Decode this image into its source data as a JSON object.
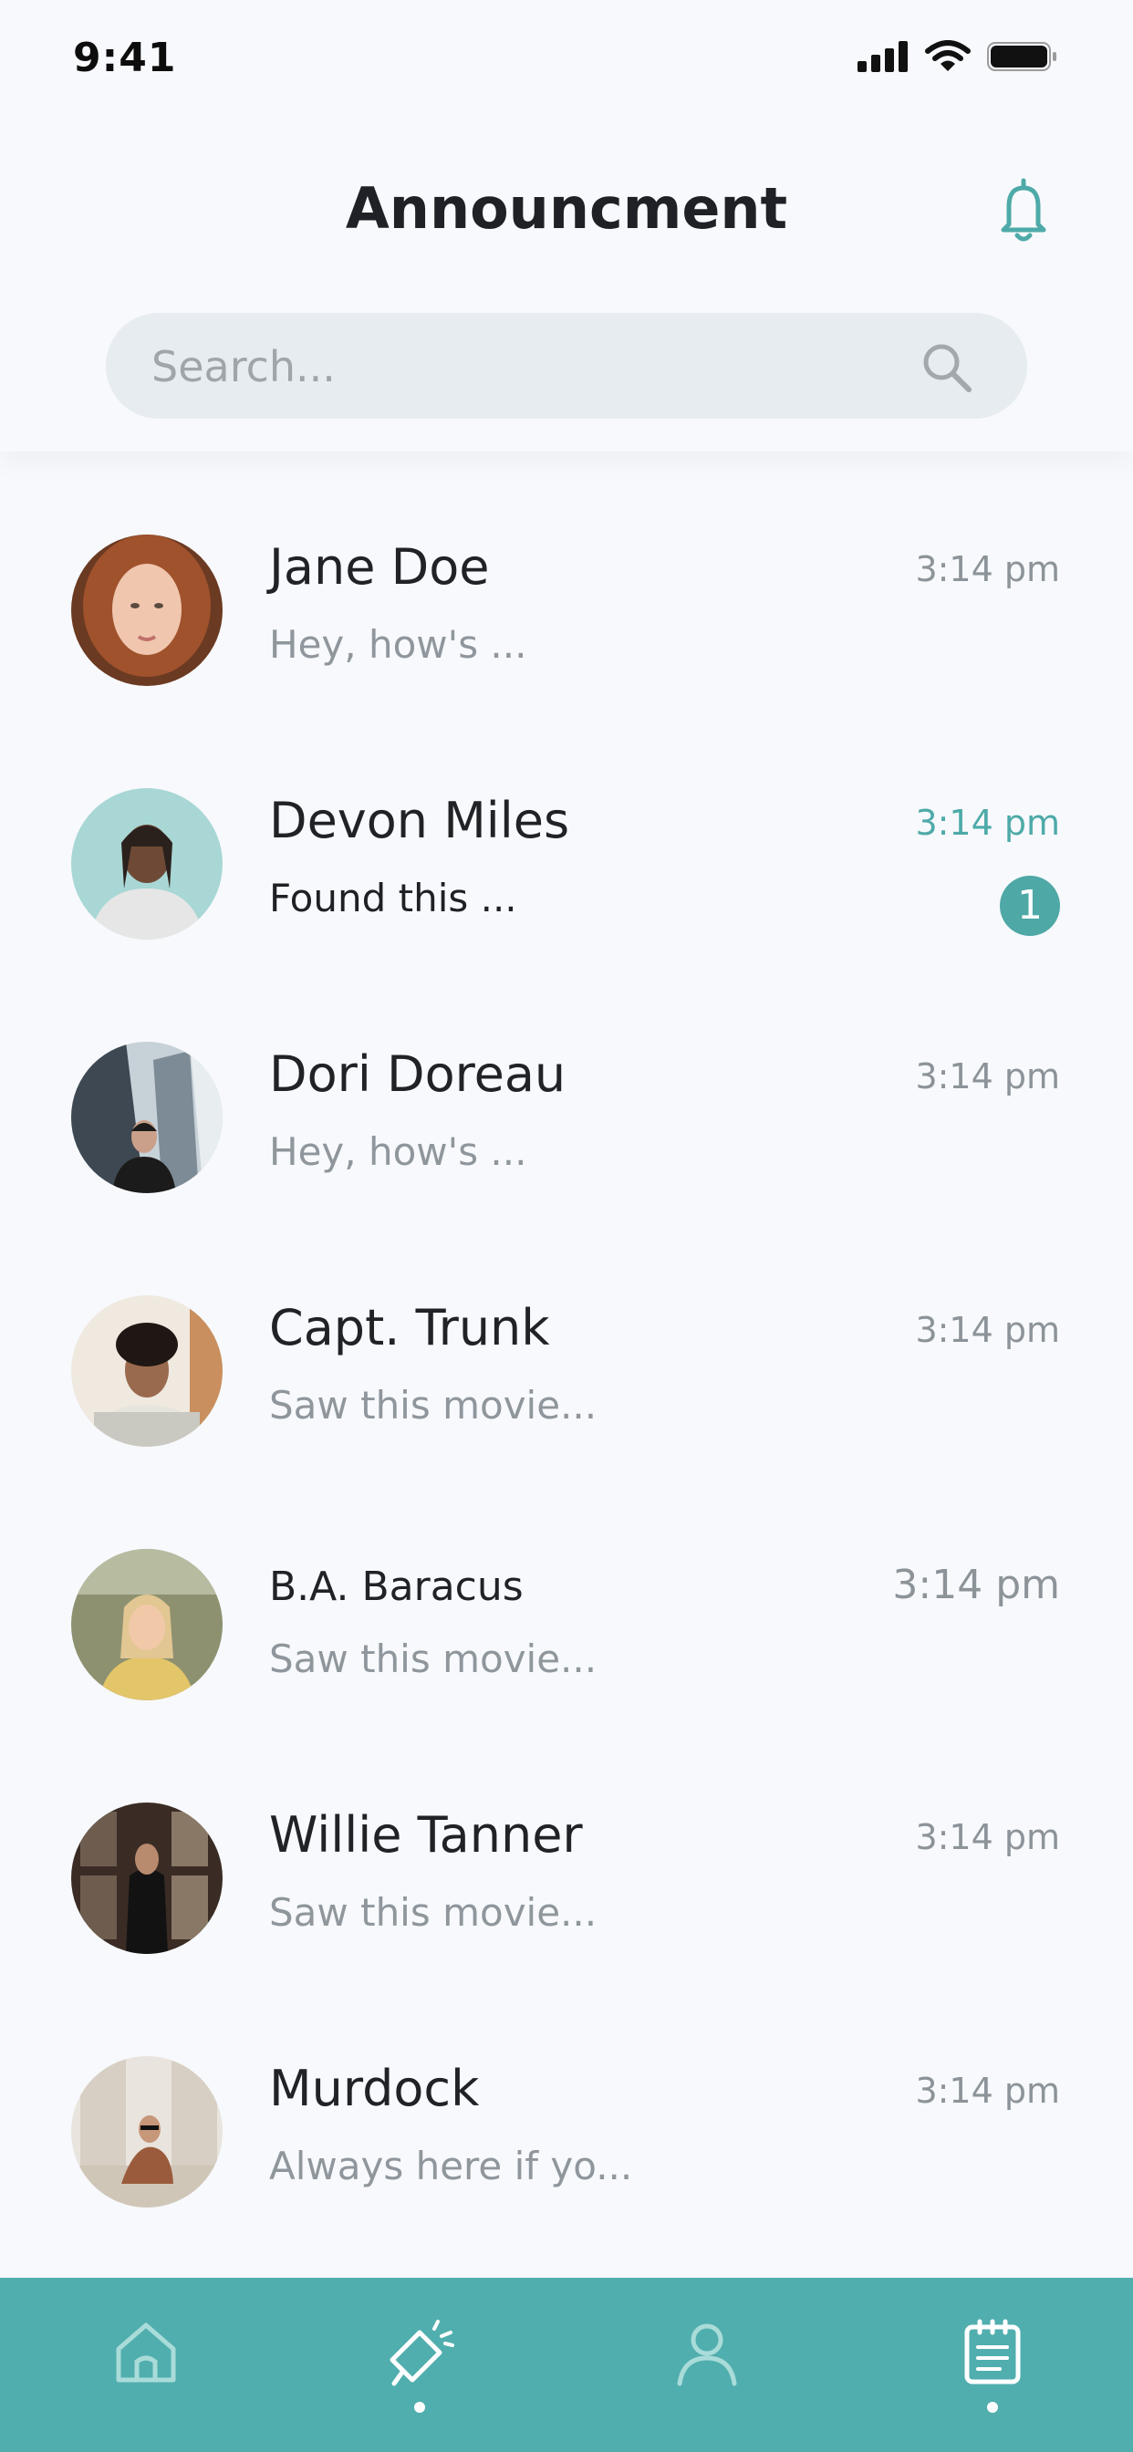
{
  "status": {
    "time": "9:41"
  },
  "header": {
    "title": "Announcment"
  },
  "search": {
    "placeholder": "Search..."
  },
  "colors": {
    "accent": "#4eaaa8",
    "nav_bg": "#51aeae",
    "muted": "#8f969c"
  },
  "messages": [
    {
      "name": "Jane Doe",
      "preview": "Hey, how's ...",
      "time": "3:14 pm"
    },
    {
      "name": "Devon Miles",
      "preview": "Found this ...",
      "time": "3:14 pm",
      "unread": 1
    },
    {
      "name": "Dori Doreau",
      "preview": "Hey, how's ...",
      "time": "3:14 pm"
    },
    {
      "name": "Capt. Trunk",
      "preview": "Saw this movie...",
      "time": "3:14 pm"
    },
    {
      "name": "B.A. Baracus",
      "preview": "Saw this movie...",
      "time": "3:14 pm"
    },
    {
      "name": "Willie Tanner",
      "preview": "Saw this movie...",
      "time": "3:14 pm"
    },
    {
      "name": "Murdock",
      "preview": "Always here if yo...",
      "time": "3:14 pm"
    }
  ],
  "nav": [
    {
      "icon": "home-icon",
      "active": false
    },
    {
      "icon": "megaphone-icon",
      "active": true
    },
    {
      "icon": "profile-icon",
      "active": false
    },
    {
      "icon": "notepad-icon",
      "active": true
    }
  ]
}
